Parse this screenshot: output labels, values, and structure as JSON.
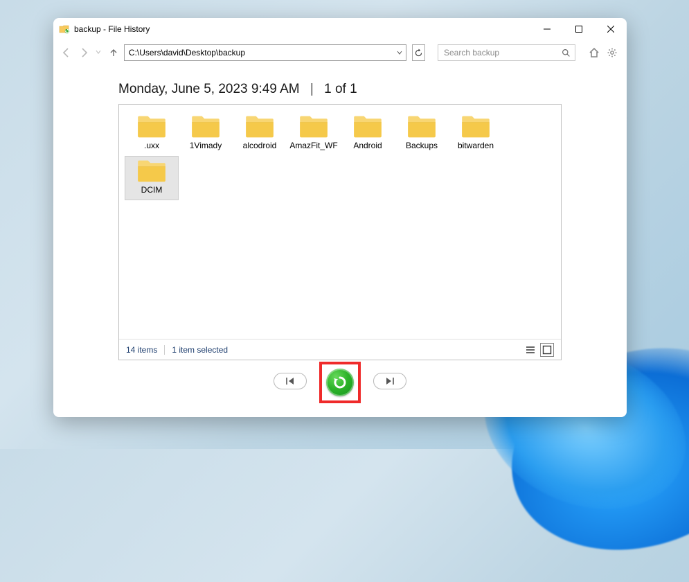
{
  "window": {
    "title": "backup - File History"
  },
  "nav": {
    "path": "C:\\Users\\david\\Desktop\\backup"
  },
  "search": {
    "placeholder": "Search backup"
  },
  "snapshot": {
    "datetime": "Monday, June 5, 2023 9:49 AM",
    "counter": "1 of 1"
  },
  "folders": [
    {
      "name": ".uxx",
      "selected": false
    },
    {
      "name": "1Vimady",
      "selected": false
    },
    {
      "name": "alcodroid",
      "selected": false
    },
    {
      "name": "AmazFit_WF",
      "selected": false
    },
    {
      "name": "Android",
      "selected": false
    },
    {
      "name": "Backups",
      "selected": false
    },
    {
      "name": "bitwarden",
      "selected": false
    },
    {
      "name": "DCIM",
      "selected": true
    }
  ],
  "status": {
    "item_count": "14 items",
    "selection": "1 item selected"
  }
}
